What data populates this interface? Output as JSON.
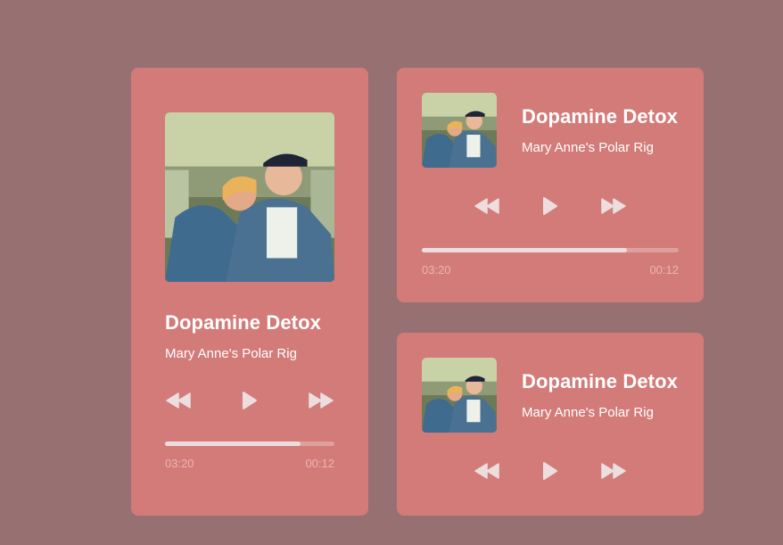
{
  "colors": {
    "page_background": "#977171",
    "card_background": "#d37b79",
    "text_primary": "#ffffff",
    "progress_fill": "#ecdede",
    "time_text": "#eab5b3",
    "control_icon": "#ecdede"
  },
  "players": {
    "large": {
      "title": "Dopamine Detox",
      "artist": "Mary Anne's Polar Rig",
      "elapsed": "03:20",
      "total": "00:12",
      "progress": 0.8,
      "controls": [
        "rewind-icon",
        "play-icon",
        "fast-forward-icon"
      ]
    },
    "compact_with_progress": {
      "title": "Dopamine Detox",
      "artist": "Mary Anne's Polar Rig",
      "elapsed": "03:20",
      "total": "00:12",
      "progress": 0.8,
      "controls": [
        "rewind-icon",
        "play-icon",
        "fast-forward-icon"
      ]
    },
    "compact": {
      "title": "Dopamine Detox",
      "artist": "Mary Anne's Polar Rig",
      "controls": [
        "rewind-icon",
        "play-icon",
        "fast-forward-icon"
      ]
    }
  }
}
